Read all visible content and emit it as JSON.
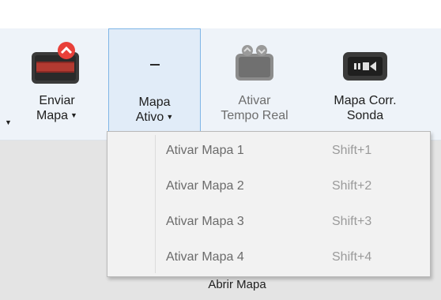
{
  "ribbon": {
    "enviar": {
      "line1": "Enviar",
      "line2": "Mapa",
      "icon": "monitor-upload-icon"
    },
    "mapa_ativo": {
      "symbol": "–",
      "line1": "Mapa",
      "line2": "Ativo"
    },
    "tempo_real": {
      "line1": "Ativar",
      "line2": "Tempo Real",
      "icon": "realtime-device-icon"
    },
    "corr_sonda": {
      "line1": "Mapa Corr.",
      "line2": "Sonda",
      "icon": "sonda-device-icon"
    },
    "dropdown_caret": "▼"
  },
  "dropdown": {
    "items": [
      {
        "label": "Ativar Mapa 1",
        "shortcut": "Shift+1"
      },
      {
        "label": "Ativar Mapa 2",
        "shortcut": "Shift+2"
      },
      {
        "label": "Ativar Mapa 3",
        "shortcut": "Shift+3"
      },
      {
        "label": "Ativar Mapa 4",
        "shortcut": "Shift+4"
      }
    ]
  },
  "footer": {
    "open_map_label": "Abrir Mapa"
  },
  "colors": {
    "ribbon_bg": "#eef3f9",
    "selected_border": "#7fb5e6",
    "badge_red": "#e8403a"
  }
}
